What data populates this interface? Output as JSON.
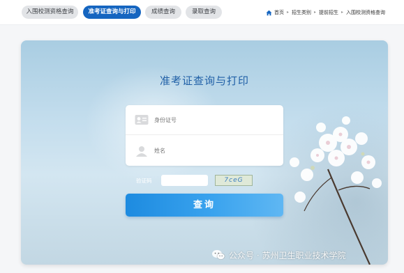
{
  "nav": {
    "tabs": [
      {
        "label": "入围校测资格查询",
        "active": false
      },
      {
        "label": "准考证查询与打印",
        "active": true
      },
      {
        "label": "成绩查询",
        "active": false
      },
      {
        "label": "录取查询",
        "active": false
      }
    ],
    "breadcrumb": [
      "首页",
      "招生类别",
      "提前招生",
      "入围校测资格查询"
    ]
  },
  "hero": {
    "title": "准考证查询与打印",
    "fields": {
      "id_placeholder": "身份证号",
      "name_placeholder": "姓名"
    },
    "captcha": {
      "label": "验证码",
      "image_text": "7ceG"
    },
    "submit_label": "查询"
  },
  "watermark": {
    "text": "公众号 · 苏州卫生职业技术学院"
  },
  "colors": {
    "accent": "#1565c0",
    "title": "#1f5fa6",
    "button": "#2a97e8"
  }
}
